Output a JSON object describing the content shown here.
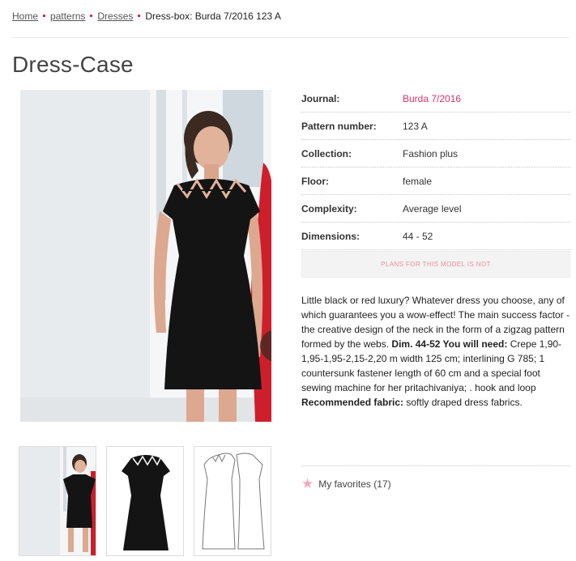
{
  "breadcrumb": {
    "items": [
      "Home",
      "patterns",
      "Dresses"
    ],
    "current": "Dress-box: Burda 7/2016 123 A"
  },
  "page": {
    "title": "Dress-Case"
  },
  "specs": [
    {
      "label": "Journal:",
      "value": "Burda 7/2016"
    },
    {
      "label": "Pattern number:",
      "value": "123 A"
    },
    {
      "label": "Collection:",
      "value": "Fashion plus"
    },
    {
      "label": "Floor:",
      "value": "female"
    },
    {
      "label": "Complexity:",
      "value": "Average level"
    },
    {
      "label": "Dimensions:",
      "value": "44 - 52"
    }
  ],
  "plans_notice": "PLANS FOR THIS MODEL IS NOT",
  "description": {
    "intro": "Little black or red luxury? Whatever dress you choose, any of which guarantees you a wow-effect! The main success factor - the creative design of the neck in the form of a zigzag pattern formed by the webs.",
    "need_label": "Dim. 44-52 You will need:",
    "need_text": "Crepe 1,90-1,95-1,95-2,15-2,20 m width 125 cm; interlining G 785; 1 countersunk fastener length of 60 cm and a special foot sewing machine for her pritachivaniya; . hook and loop",
    "fabric_label": "Recommended fabric:",
    "fabric_text": "softly draped dress fabrics."
  },
  "favorites": {
    "label": "My favorites (17)",
    "icon": "star-icon"
  },
  "colors": {
    "accent": "#d6336c",
    "star": "#f5a8bd",
    "dress": "#141414",
    "red_dress": "#cc1f2b"
  }
}
